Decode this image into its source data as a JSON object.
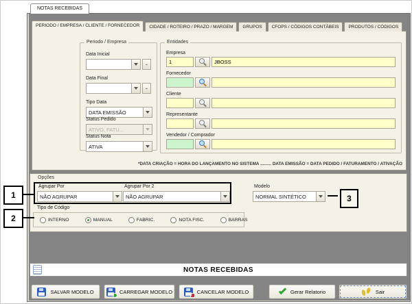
{
  "app": {
    "outer_tab_label": "NOTAS RECEBIDAS"
  },
  "tabs": [
    {
      "label": "PERIODO / EMPRESA / CLIENTE / FORNECEDOR"
    },
    {
      "label": "CIDADE / ROTEIRO / PRAZO / MARGEM"
    },
    {
      "label": "GRUPOS"
    },
    {
      "label": "CFOPS / CÓDIGOS CONTÁBEIS"
    },
    {
      "label": "PRODUTOS / CÓDIGOS"
    }
  ],
  "periodo": {
    "title": "Periodo / Empresa",
    "data_inicial": {
      "label": "Data Inicial",
      "value": "",
      "minus": "-"
    },
    "data_final": {
      "label": "Data Final",
      "value": "",
      "minus": "-"
    },
    "tipo_data": {
      "label": "Tipo Data",
      "value": "DATA EMISSÃO"
    },
    "status_pedido": {
      "label": "Status Pedido",
      "value": "ATIVO, FATU..."
    },
    "status_nota": {
      "label": "Status Nota",
      "value": "ATIVA"
    }
  },
  "entidades": {
    "title": "Entidades",
    "rows": [
      {
        "label": "Empresa",
        "code": "1",
        "name": "JBOSS"
      },
      {
        "label": "Fornecedor",
        "code": "",
        "name": ""
      },
      {
        "label": "Cliente",
        "code": "",
        "name": ""
      },
      {
        "label": "Representante",
        "code": "",
        "name": ""
      },
      {
        "label": "Vendedor / Comprador",
        "code": "",
        "name": ""
      }
    ],
    "footnote": "*DATA CRIAÇÃO = HORA DO LANÇAMENTO NO SISTEMA ......... DATA EMISSÃO = DATA PEDIDO / FATURAMENTO / ATIVAÇÃO"
  },
  "opcoes": {
    "title": "Opções",
    "agrupar_por": {
      "label": "Agrupar Por",
      "value": "NÃO AGRUPAR"
    },
    "agrupar_por_2": {
      "label": "Agrupar Por 2",
      "value": "NÃO AGRUPAR"
    },
    "modelo": {
      "label": "Modelo",
      "value": "NORMAL SINTÉTICO"
    },
    "tipo_codigo": {
      "label": "Tipo de Código",
      "options": [
        {
          "label": "INTERNO",
          "selected": false
        },
        {
          "label": "MANUAL",
          "selected": true
        },
        {
          "label": "FABRIC.",
          "selected": false
        },
        {
          "label": "NOTA FISC.",
          "selected": false
        },
        {
          "label": "BARRAS",
          "selected": false
        }
      ]
    }
  },
  "annotations": {
    "marker_1": "1",
    "marker_2": "2",
    "marker_3": "3"
  },
  "footer": {
    "report_title": "NOTAS RECEBIDAS",
    "salvar_label": "SALVAR MODELO",
    "carregar_label": "CARREGAR MODELO",
    "cancelar_label": "CANCELAR MODELO",
    "gerar_label": "Gerar Relatorio",
    "sair_label": "Sair"
  },
  "colors": {
    "field_yellow": "#FFFFC8",
    "field_green": "#CDF5CD",
    "panel_beige": "#F4F1E7",
    "window_gray": "#848484",
    "annotation_black": "#000000",
    "check_green": "#2FA52F",
    "floppy_blue": "#2B5BC4",
    "cancel_red": "#D03030",
    "footprint_yellow": "#E2BE2A"
  }
}
